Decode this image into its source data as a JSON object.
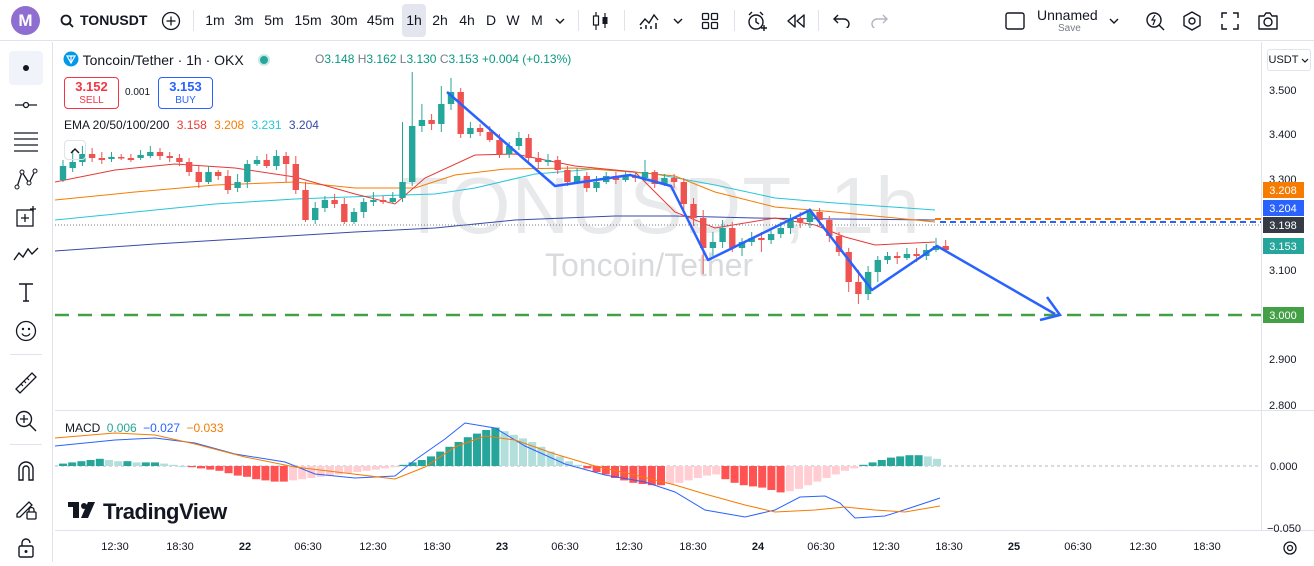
{
  "toolbar": {
    "logo_letter": "M",
    "symbol": "TONUSDT",
    "intervals": [
      "1m",
      "3m",
      "5m",
      "15m",
      "30m",
      "45m",
      "1h",
      "2h",
      "4h",
      "D",
      "W",
      "M"
    ],
    "active_interval": "1h",
    "layout_name": "Unnamed",
    "layout_save": "Save"
  },
  "legend": {
    "title": "Toncoin/Tether · 1h · OKX",
    "o_label": "O",
    "o": "3.148",
    "h_label": "H",
    "h": "3.162",
    "l_label": "L",
    "l": "3.130",
    "c_label": "C",
    "c": "3.153",
    "change": "+0.004 (+0.13%)",
    "sell_price": "3.152",
    "sell_label": "SELL",
    "spread": "0.001",
    "buy_price": "3.153",
    "buy_label": "BUY"
  },
  "ema": {
    "label": "EMA 20/50/100/200",
    "values": [
      "3.158",
      "3.208",
      "3.231",
      "3.204"
    ],
    "colors": [
      "#e53935",
      "#f57c00",
      "#26c6da",
      "#3949ab"
    ]
  },
  "watermark": {
    "symbol": "TONUSDT, 1h",
    "name": "Toncoin/Tether"
  },
  "price_axis": {
    "unit": "USDT",
    "ticks": [
      "3.500",
      "3.400",
      "3.300",
      "3.100",
      "2.900",
      "2.800"
    ],
    "labels": {
      "ema50": "3.208",
      "ema200": "3.204",
      "prev": "3.198",
      "last": "3.153",
      "level": "3.000"
    }
  },
  "macd": {
    "label": "MACD",
    "values": [
      "0.006",
      "−0.027",
      "−0.033"
    ],
    "colors": [
      "#26a69a",
      "#2962ff",
      "#f57c00"
    ],
    "axis": [
      "0.000",
      "−0.050"
    ]
  },
  "time_axis": [
    "12:30",
    "18:30",
    "22",
    "06:30",
    "12:30",
    "18:30",
    "23",
    "06:30",
    "12:30",
    "18:30",
    "24",
    "06:30",
    "12:30",
    "18:30",
    "25",
    "06:30",
    "12:30",
    "18:30"
  ],
  "branding": "TradingView",
  "colors": {
    "up": "#26a69a",
    "down": "#ef5350",
    "drawing": "#2962ff",
    "level": "#43a047"
  }
}
